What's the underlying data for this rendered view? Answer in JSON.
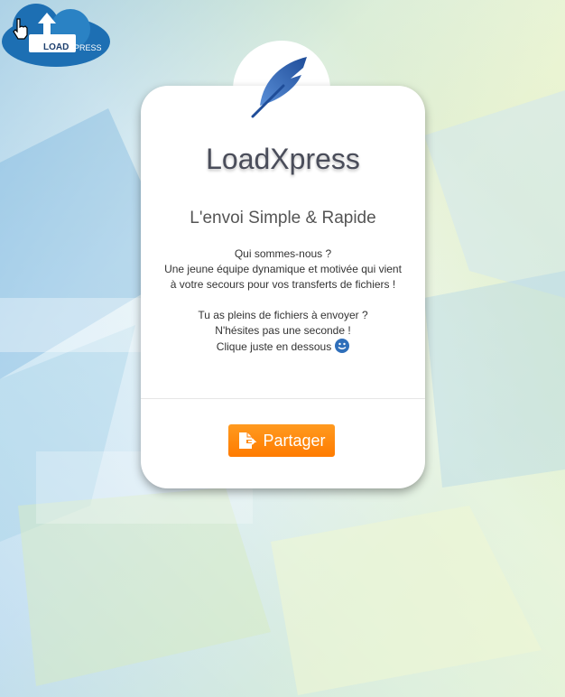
{
  "brand": {
    "logo_text_small": "LOAD",
    "logo_text_big": "XPRESS",
    "logo_icon": "upload-cloud-icon"
  },
  "card": {
    "badge_icon": "feather-icon",
    "title": "LoadXpress",
    "subtitle": "L'envoi Simple & Rapide",
    "desc_lines": [
      "Qui sommes-nous ?",
      "Une jeune équipe dynamique et motivée qui vient",
      "à votre secours pour vos transferts de fichiers !",
      "Tu as pleins de fichiers à envoyer ?",
      "N'hésites pas une seconde !",
      "Clique juste en dessous"
    ],
    "smile_icon": "smile-icon",
    "share_button": {
      "label": "Partager",
      "icon": "file-export-icon",
      "color": "#ff8c00"
    }
  },
  "cursor_icon": "hand-pointer-icon"
}
